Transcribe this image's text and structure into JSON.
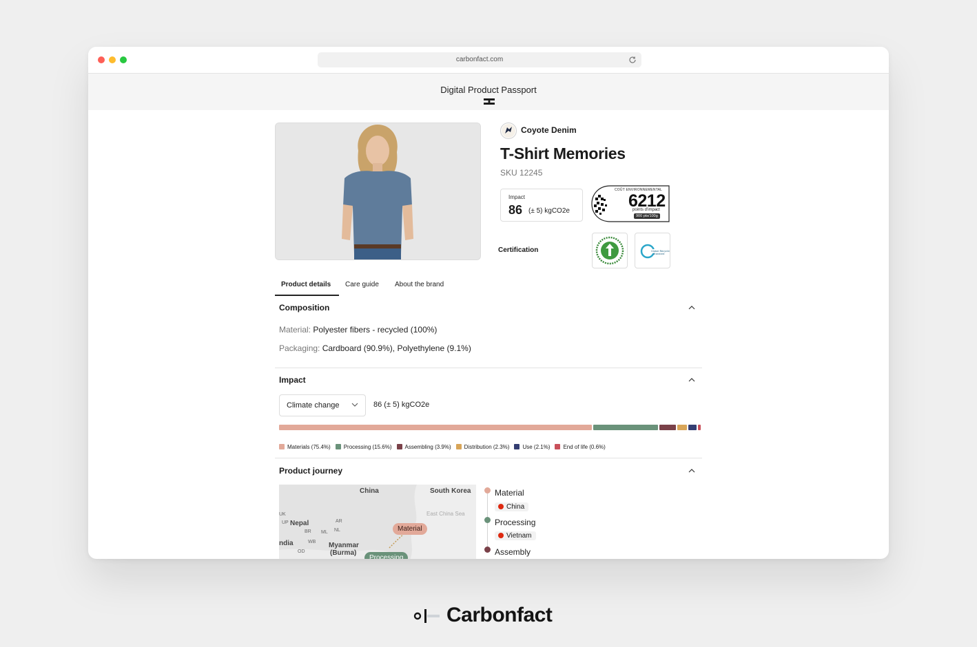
{
  "browser": {
    "url": "carbonfact.com"
  },
  "header": {
    "title": "Digital Product Passport"
  },
  "product": {
    "brand": "Coyote Denim",
    "name": "T-Shirt Memories",
    "sku": "SKU 12245"
  },
  "impact_card": {
    "label": "Impact",
    "value": "86",
    "unit": "(± 5) kgCO2e"
  },
  "eco_badge": {
    "heading": "COÛT ENVIRONNEMENTAL",
    "value": "6212",
    "sub": "points d'impact",
    "pill": "900 pts/100g"
  },
  "certification": {
    "label": "Certification",
    "items": [
      {
        "name": "GOTS",
        "icon": "gots-certification-icon"
      },
      {
        "name": "Global Recycled Standard",
        "icon": "grs-certification-icon"
      }
    ]
  },
  "tabs": [
    {
      "label": "Product details",
      "active": true
    },
    {
      "label": "Care guide",
      "active": false
    },
    {
      "label": "About the brand",
      "active": false
    }
  ],
  "composition": {
    "title": "Composition",
    "material_key": "Material:",
    "material_value": "Polyester fibers - recycled (100%)",
    "packaging_key": "Packaging:",
    "packaging_value": "Cardboard (90.9%), Polyethylene (9.1%)"
  },
  "impact_section": {
    "title": "Impact",
    "selected_metric": "Climate change",
    "total": "86 (± 5) kgCO2e",
    "breakdown": [
      {
        "name": "Materials (75.4%)",
        "share": 75.4,
        "color": "#e2a999"
      },
      {
        "name": "Processing (15.6%)",
        "share": 15.6,
        "color": "#6a927a"
      },
      {
        "name": "Assembling (3.9%)",
        "share": 3.9,
        "color": "#7a4149"
      },
      {
        "name": "Distribution (2.3%)",
        "share": 2.3,
        "color": "#d8a558"
      },
      {
        "name": "Use (2.1%)",
        "share": 2.1,
        "color": "#343e72"
      },
      {
        "name": "End of life (0.6%)",
        "share": 0.6,
        "color": "#c9505a"
      }
    ]
  },
  "journey": {
    "title": "Product journey",
    "map_labels": {
      "china": "China",
      "south_korea": "South Korea",
      "sea": "East China Sea",
      "nepal": "Nepal",
      "uk": "UK",
      "up": "UP",
      "ar": "AR",
      "br": "BR",
      "ml": "ML",
      "nl": "NL",
      "india": "ndia",
      "wb": "WB",
      "od": "OD",
      "myanmar": "Myanmar",
      "burma": "(Burma)"
    },
    "map_pills": {
      "material": "Material",
      "processing": "Processing"
    },
    "stages": [
      {
        "stage": "Material",
        "country": "China",
        "color": "#e2a999"
      },
      {
        "stage": "Processing",
        "country": "Vietnam",
        "color": "#6a927a"
      },
      {
        "stage": "Assembly",
        "country": "",
        "color": "#7a4149"
      }
    ]
  },
  "footer": {
    "brand": "Carbonfact"
  }
}
